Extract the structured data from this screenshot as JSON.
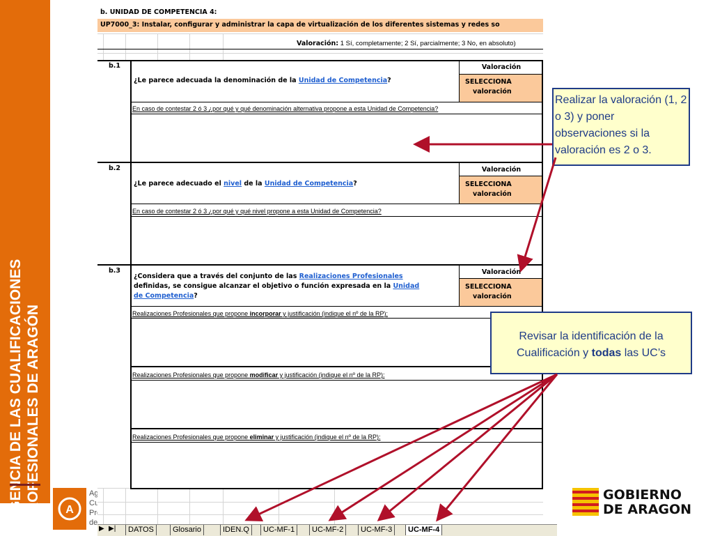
{
  "agency": {
    "band_line1": "AGENCIA DE LAS CUALIFICACIONES",
    "band_line2": "PROFESIONALES DE ARAGÓN",
    "logo_lines": [
      "Ag",
      "Cu",
      "Pro",
      "de"
    ]
  },
  "sheet": {
    "title": "b. UNIDAD DE COMPETENCIA 4:",
    "unit_row": "UP7000_3: Instalar, configurar y administrar la capa de virtualización de los diferentes sistemas y redes so",
    "valoracion_legend_bold": "Valoración:",
    "valoracion_legend_rest": " 1 Sí, completamente; 2 Sí, parcialmente; 3 No, en absoluto)",
    "sections": [
      {
        "id": "b.1",
        "q_pre": "¿Le parece adecuada la denominación de la ",
        "q_link1": "Unidad de Competencia",
        "q_post": "?",
        "val_head": "Valoración",
        "sel1": "SELECCIONA",
        "sel2": "valoración",
        "note": "En caso de contestar 2 ó 3 ¿por qué y qué denominación alternativa propone a esta Unidad de Competencia?"
      },
      {
        "id": "b.2",
        "q_pre": "¿Le parece adecuado el ",
        "q_link1": "nivel",
        "q_mid": " de la ",
        "q_link2": "Unidad de Competencia",
        "q_post": "?",
        "val_head": "Valoración",
        "sel1": "SELECCIONA",
        "sel2": "valoración",
        "note": "En caso de contestar 2 ó 3 ¿por qué y qué nivel propone a esta Unidad de Competencia?"
      },
      {
        "id": "b.3",
        "q_line1_pre": "¿Considera que a través del conjunto de las ",
        "q_line1_link": "Realizaciones Profesionales",
        "q_line2_pre": "definidas, se consigue alcanzar el objetivo o función expresada en la ",
        "q_line2_link": "Unidad",
        "q_line3_link": "de Competencia",
        "q_post": "?",
        "val_head": "Valoración",
        "sel1": "SELECCIONA",
        "sel2": "valoración",
        "rp_incorporar_pre": "Realizaciones Profesionales que propone ",
        "rp_incorporar_bold": "incorporar",
        "rp_incorporar_post": " y justificación (indique el nº de la RP):",
        "rp_modificar_pre": "Realizaciones Profesionales que propone ",
        "rp_modificar_bold": "modificar",
        "rp_modificar_post": " y justificación (indique el nº de la RP):",
        "rp_eliminar_pre": "Realizaciones Profesionales que propone ",
        "rp_eliminar_bold": "eliminar",
        "rp_eliminar_post": " y justificación (indique el nº de la RP):"
      }
    ]
  },
  "tabs": [
    {
      "label": "DATOS",
      "active": false
    },
    {
      "label": "Glosario",
      "active": false
    },
    {
      "label": "IDEN.Q",
      "active": false
    },
    {
      "label": "UC-MF-1",
      "active": false
    },
    {
      "label": "UC-MF-2",
      "active": false
    },
    {
      "label": "UC-MF-3",
      "active": false
    },
    {
      "label": "UC-MF-4",
      "active": true
    }
  ],
  "callouts": {
    "valoracion": "Realizar la valoración (1, 2 o 3) y poner observaciones si la valoración es 2 o 3.",
    "revisar_pre": "Revisar la identificación de la Cualificación y  ",
    "revisar_bold": "todas",
    "revisar_post": " las UC’s"
  },
  "gobierno": {
    "line1": "GOBIERNO",
    "line2": "DE ARAGON"
  },
  "colors": {
    "band": "#e36c0a",
    "cell_orange": "#fbc99b",
    "callout_bg": "#ffffcc",
    "callout_border": "#1f3b87",
    "arrow": "#b0102a"
  }
}
